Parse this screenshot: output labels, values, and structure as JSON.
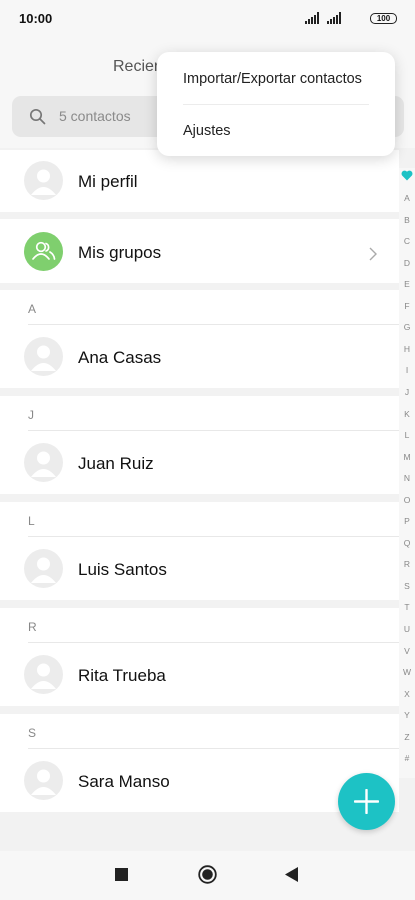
{
  "status": {
    "time": "10:00",
    "battery": "100"
  },
  "header": {
    "tab_label": "Recier"
  },
  "search": {
    "placeholder": "5 contactos"
  },
  "profile": {
    "label": "Mi perfil"
  },
  "groups": {
    "label": "Mis grupos"
  },
  "sections": [
    {
      "letter": "A",
      "contact": "Ana Casas"
    },
    {
      "letter": "J",
      "contact": "Juan Ruiz"
    },
    {
      "letter": "L",
      "contact": "Luis Santos"
    },
    {
      "letter": "R",
      "contact": "Rita Trueba"
    },
    {
      "letter": "S",
      "contact": "Sara Manso"
    }
  ],
  "index": [
    "A",
    "B",
    "C",
    "D",
    "E",
    "F",
    "G",
    "H",
    "I",
    "J",
    "K",
    "L",
    "M",
    "N",
    "O",
    "P",
    "Q",
    "R",
    "S",
    "T",
    "U",
    "V",
    "W",
    "X",
    "Y",
    "Z",
    "#"
  ],
  "menu": {
    "items": [
      "Importar/Exportar contactos",
      "Ajustes"
    ]
  },
  "colors": {
    "accent": "#1dc2c5",
    "groups": "#7fcf6e"
  }
}
